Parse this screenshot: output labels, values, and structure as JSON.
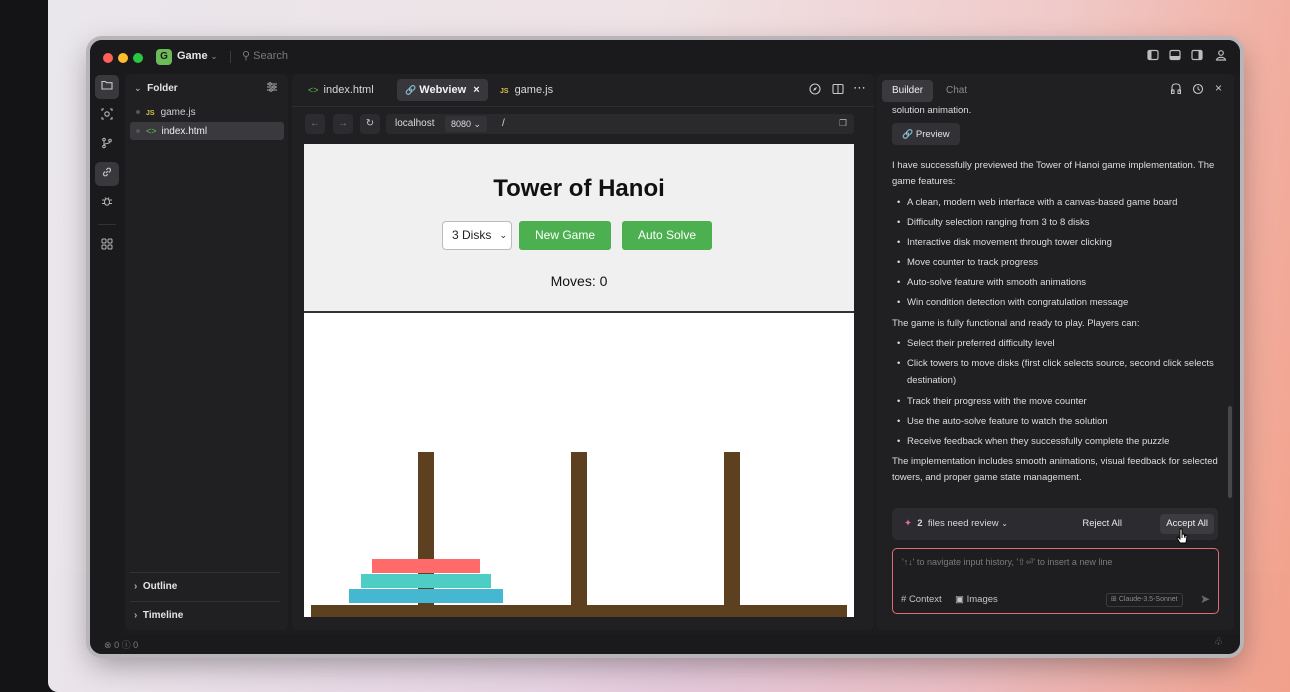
{
  "titlebar": {
    "app_badge": "G",
    "app_name": "Game",
    "search_placeholder": "Search"
  },
  "explorer": {
    "folder_label": "Folder",
    "files": [
      {
        "type": "JS",
        "name": "game.js"
      },
      {
        "type": "html",
        "name": "index.html"
      }
    ],
    "outline_label": "Outline",
    "timeline_label": "Timeline"
  },
  "editor": {
    "tabs": [
      {
        "label": "index.html"
      },
      {
        "label": "Webview"
      },
      {
        "label": "game.js"
      }
    ],
    "address": {
      "host": "localhost",
      "port": "8080",
      "path": "/"
    }
  },
  "game": {
    "title": "Tower of Hanoi",
    "disk_select_value": "3 Disks",
    "new_game_label": "New Game",
    "auto_solve_label": "Auto Solve",
    "moves_label": "Moves: 0",
    "colors": {
      "disk_small": "#ff6b6b",
      "disk_medium": "#4ecdc4",
      "disk_large": "#45b7d1",
      "tower": "#5d4020",
      "button": "#4caf50"
    }
  },
  "chat": {
    "tab_builder": "Builder",
    "tab_chat": "Chat",
    "prev_tail": "solution animation.",
    "preview_label": "Preview",
    "intro": "I have successfully previewed the Tower of Hanoi game implementation. The game features:",
    "features": [
      "A clean, modern web interface with a canvas-based game board",
      "Difficulty selection ranging from 3 to 8 disks",
      "Interactive disk movement through tower clicking",
      "Move counter to track progress",
      "Auto-solve feature with smooth animations",
      "Win condition detection with congratulation message"
    ],
    "players_intro": "The game is fully functional and ready to play. Players can:",
    "player_actions": [
      "Select their preferred difficulty level",
      "Click towers to move disks (first click selects source, second click selects destination)",
      "Track their progress with the move counter",
      "Use the auto-solve feature to watch the solution",
      "Receive feedback when they successfully complete the puzzle"
    ],
    "summary": "The implementation includes smooth animations, visual feedback for selected towers, and proper game state management.",
    "review": {
      "count": "2",
      "text": "files need review",
      "reject_label": "Reject All",
      "accept_label": "Accept All"
    },
    "input": {
      "placeholder": "'↑↓' to navigate input history, '⇧⏎' to insert a new line",
      "context_label": "Context",
      "images_label": "Images",
      "model_label": "Claude-3.5-Sonnet"
    }
  },
  "statusbar": {
    "errors": "0",
    "warnings": "0"
  }
}
